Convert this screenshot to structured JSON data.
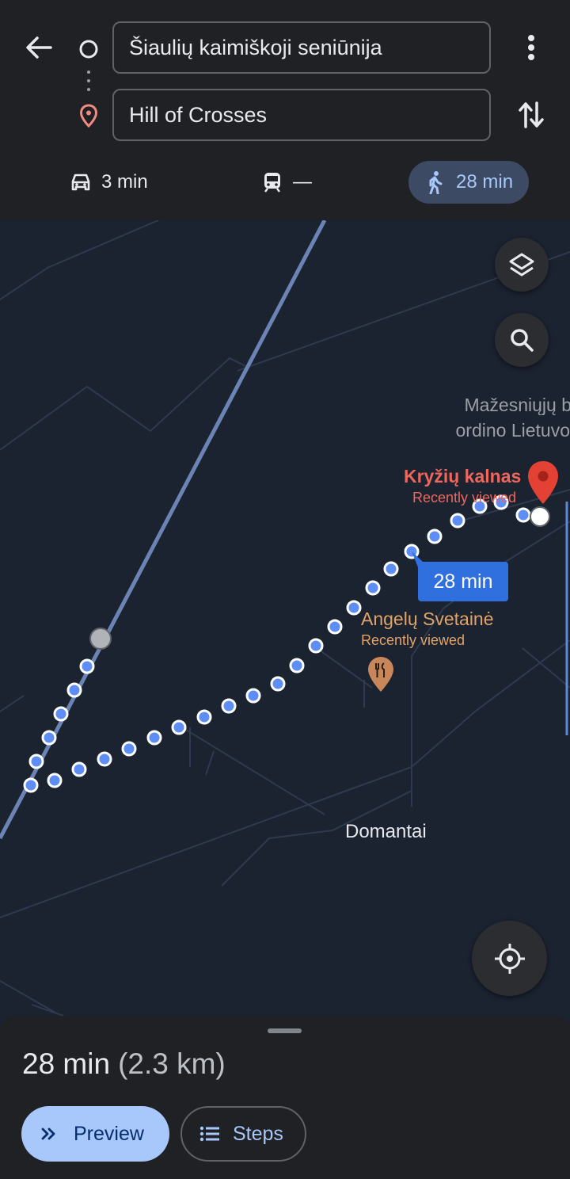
{
  "directions": {
    "origin": "Šiaulių kaimiškoji seniūnija",
    "destination": "Hill of Crosses"
  },
  "modes": [
    {
      "name": "drive",
      "label": "3 min",
      "selected": false
    },
    {
      "name": "transit",
      "label": "—",
      "selected": false
    },
    {
      "name": "walk",
      "label": "28 min",
      "selected": true
    }
  ],
  "map": {
    "labels": {
      "poi_partial_1": "Mažesniųjų b",
      "poi_partial_2": "ordino Lietuvo",
      "destination_name": "Kryžių kalnas",
      "destination_sub": "Recently viewed",
      "restaurant_name": "Angelų Svetainė",
      "restaurant_sub": "Recently viewed",
      "village": "Domantai"
    },
    "route_badge": "28 min",
    "colors": {
      "route": "#5e8ef5",
      "destination_pin": "#e34133",
      "restaurant": "#e0a46a",
      "accent": "#a8c7fa"
    }
  },
  "sheet": {
    "duration": "28 min",
    "distance": "(2.3 km)",
    "preview_label": "Preview",
    "steps_label": "Steps"
  },
  "icons": [
    "back-arrow-icon",
    "origin-circle-icon",
    "destination-pin-icon",
    "more-vert-icon",
    "swap-icon",
    "car-icon",
    "train-icon",
    "walk-icon",
    "layers-icon",
    "search-icon",
    "my-location-icon",
    "restaurant-icon",
    "double-chevron-icon",
    "list-icon"
  ]
}
